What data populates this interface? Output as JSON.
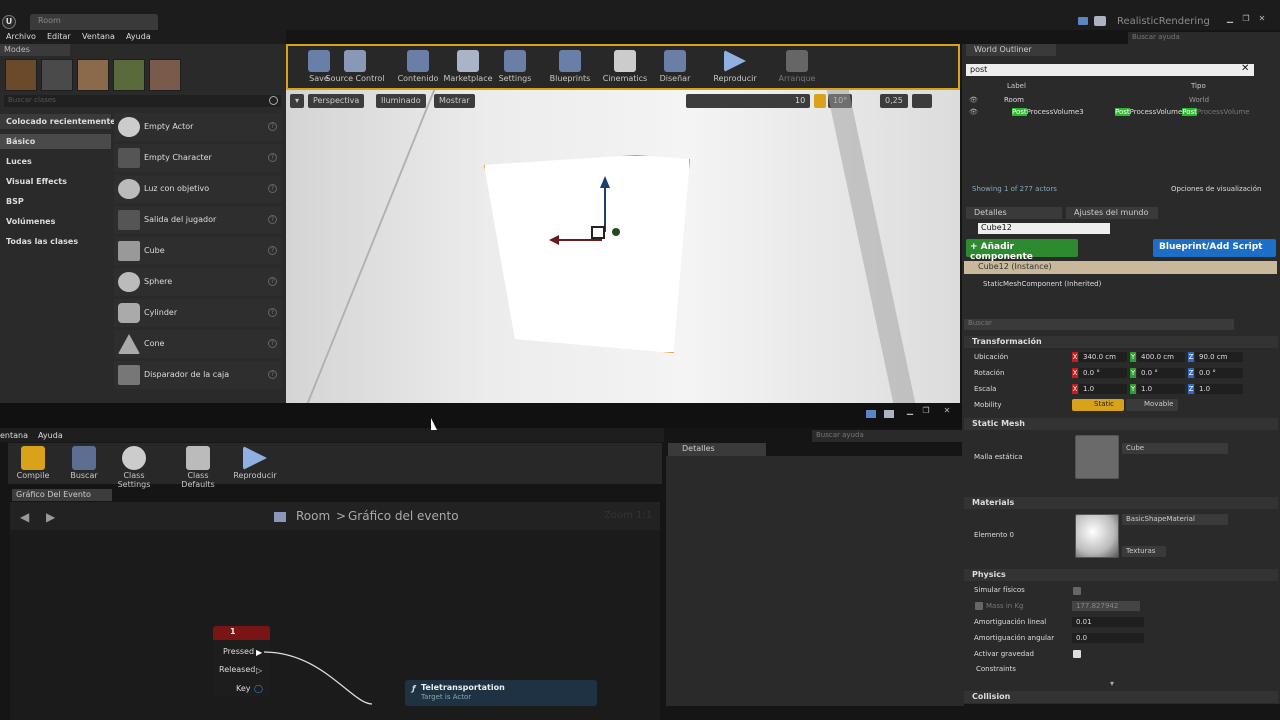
{
  "window": {
    "tab": "Room",
    "project": "RealisticRendering",
    "search_help": "Buscar ayuda"
  },
  "main_menu": [
    "Archivo",
    "Editar",
    "Ventana",
    "Ayuda"
  ],
  "modes": {
    "header": "Modes",
    "search_placeholder": "Buscar clases",
    "categories": [
      "Colocado recientemente",
      "Básico",
      "Luces",
      "Visual Effects",
      "BSP",
      "Volúmenes",
      "Todas las clases"
    ],
    "items": [
      "Empty Actor",
      "Empty Character",
      "Luz con objetivo",
      "Salida del jugador",
      "Cube",
      "Sphere",
      "Cylinder",
      "Cone",
      "Disparador de la caja"
    ]
  },
  "toolbar": {
    "buttons": [
      "Save",
      "Source Control",
      "Contenido",
      "Marketplace",
      "Settings",
      "Blueprints",
      "Cinematics",
      "Diseñar",
      "Reproducir",
      "Arranque"
    ]
  },
  "viewport": {
    "perspective": "Perspectiva",
    "lighting": "Iluminado",
    "show": "Mostrar",
    "grid": "10",
    "angle": "10°",
    "scale": "0,25"
  },
  "blueprint": {
    "menu": [
      "entana",
      "Ayuda"
    ],
    "search_help": "Buscar ayuda",
    "toolbar": [
      "Compile",
      "Buscar",
      "Class Settings",
      "Class Defaults",
      "Reproducir"
    ],
    "graph_tab": "Gráfico Del Evento",
    "breadcrumb_root": "Room",
    "breadcrumb_sep": ">",
    "breadcrumb_leaf": "Gráfico del evento",
    "zoom": "Zoom 1:1",
    "details_tab": "Detalles",
    "node1": {
      "title": "1",
      "pins": [
        "Pressed",
        "Released",
        "Key"
      ]
    },
    "node2": {
      "title": "Teletransportation",
      "subtitle": "Target is Actor"
    }
  },
  "outliner": {
    "title": "World Outliner",
    "search": "post",
    "col_label": "Label",
    "col_type": "Tipo",
    "rows": [
      {
        "label": "Room",
        "type": "World"
      },
      {
        "label_hl": "Post",
        "label_rest": "ProcessVolume3",
        "type_hl": "Post",
        "type_rest": "ProcessVolume",
        "type2_hl": "Post",
        "type2_rest": "ProcessVolume"
      }
    ],
    "status": "Showing 1 of 277 actors",
    "view_options": "Opciones de visualización"
  },
  "details": {
    "tab1": "Detalles",
    "tab2": "Ajustes del mundo",
    "name": "Cube12",
    "add_component": "+ Añadir componente",
    "blueprint_btn": "Blueprint/Add Script",
    "instance": "Cube12 (Instance)",
    "component": "StaticMeshComponent (Inherited)",
    "search_placeholder": "Buscar",
    "transform": {
      "title": "Transformación",
      "location_label": "Ubicación",
      "location": [
        "340.0 cm",
        "400.0 cm",
        "90.0 cm"
      ],
      "rotation_label": "Rotación",
      "rotation": [
        "0.0 °",
        "0.0 °",
        "0.0 °"
      ],
      "scale_label": "Escala",
      "scale": [
        "1.0",
        "1.0",
        "1.0"
      ],
      "mobility_label": "Mobility",
      "mobility_static": "Static",
      "mobility_movable": "Movable"
    },
    "static_mesh": {
      "title": "Static Mesh",
      "label": "Malla estática",
      "value": "Cube"
    },
    "materials": {
      "title": "Materials",
      "label": "Elemento 0",
      "value": "BasicShapeMaterial",
      "textures": "Texturas"
    },
    "physics": {
      "title": "Physics",
      "simulate": "Simular físicos",
      "mass_label": "Mass in Kg",
      "mass_value": "177.827942",
      "linear_label": "Amortiguación lineal",
      "linear_value": "0.01",
      "angular_label": "Amortiguación angular",
      "angular_value": "0.0",
      "gravity": "Activar gravedad",
      "constraints": "Constraints"
    },
    "collision": "Collision"
  },
  "colors": {
    "accent_orange": "#d9a21b",
    "add_green": "#2e8a2e",
    "blueprint_blue": "#1c6ec6",
    "node_red": "#7a1515",
    "highlight_green": "#2fb82f"
  }
}
